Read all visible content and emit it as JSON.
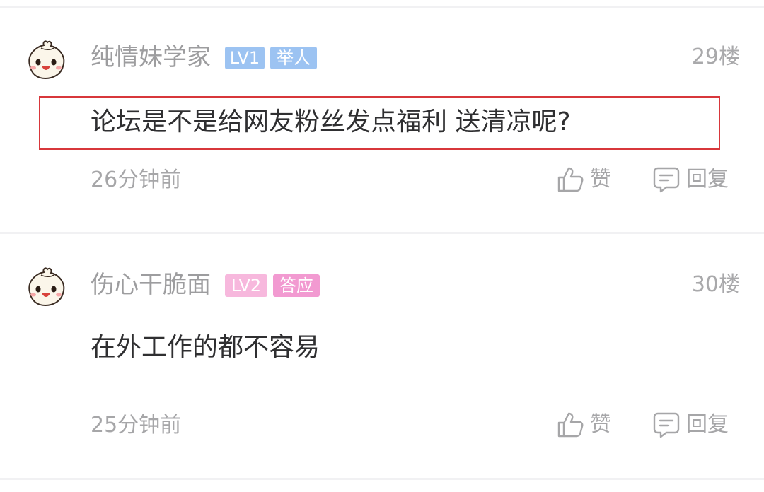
{
  "comments": [
    {
      "username": "纯情妹学家",
      "level": "LV1",
      "title": "举人",
      "level_color": "#9cc3f2",
      "title_color": "#9cc3f2",
      "floor": "29楼",
      "text": "论坛是不是给网友粉丝发点福利  送清凉呢?",
      "highlighted": true,
      "time": "26分钟前",
      "like_label": "赞",
      "reply_label": "回复"
    },
    {
      "username": "伤心干脆面",
      "level": "LV2",
      "title": "答应",
      "level_color": "#f7b8dd",
      "title_color": "#f29ad1",
      "floor": "30楼",
      "text": "在外工作的都不容易",
      "highlighted": false,
      "time": "25分钟前",
      "like_label": "赞",
      "reply_label": "回复"
    }
  ],
  "colors": {
    "highlight_border": "#d8373b",
    "divider": "#f1f1f3"
  }
}
